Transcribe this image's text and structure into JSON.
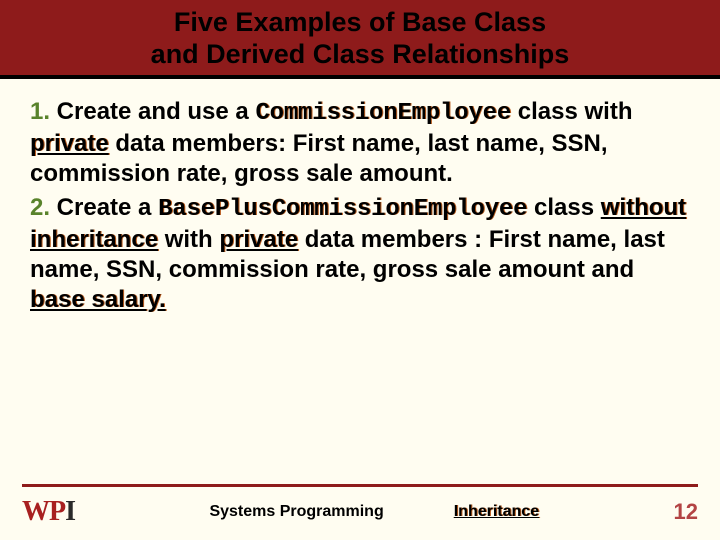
{
  "header": {
    "line1": "Five Examples of Base Class",
    "line2": "and Derived Class Relationships"
  },
  "items": [
    {
      "num": "1.",
      "lead": " Create and use a ",
      "class_token": "CommissionEmployee",
      "mid1": " class with ",
      "private_token": "private",
      "tail": " data members: First name, last name, SSN, commission rate, gross sale amount."
    },
    {
      "num": "2.",
      "lead": " Create a ",
      "class_token": "BasePlusCommissionEmployee",
      "mid1": " class ",
      "emph_token": "without inheritance",
      "mid2": " with ",
      "private_token": "private",
      "mid3": " data members : First name, last name, SSN, commission rate, gross sale amount and ",
      "basesal_token": "base salary."
    }
  ],
  "footer": {
    "logo_w": "W",
    "logo_p": "P",
    "logo_i": "I",
    "course": "Systems Programming",
    "topic": "Inheritance",
    "page": "12"
  }
}
